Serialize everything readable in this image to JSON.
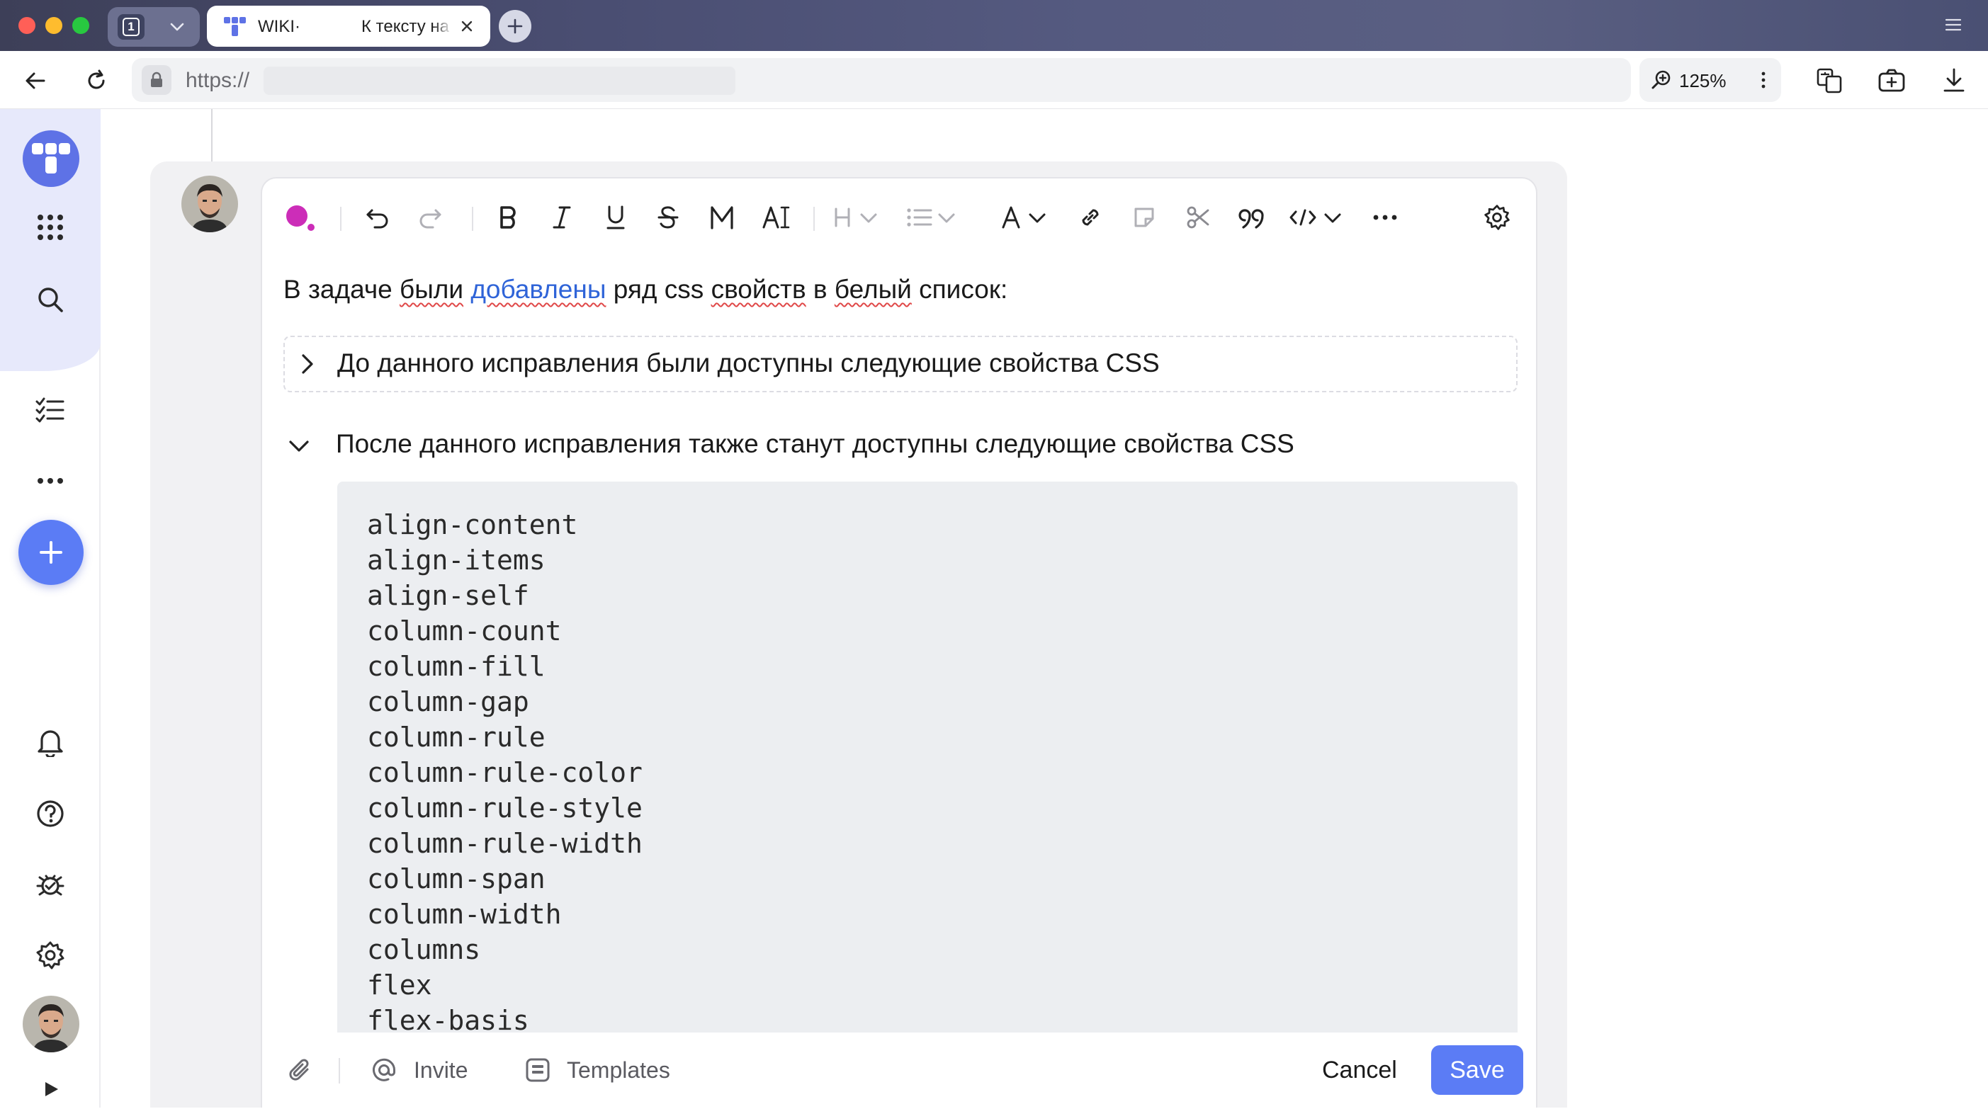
{
  "browser": {
    "tab_group_count": "1",
    "tab": {
      "title_prefix": "WIKI·",
      "title": "К тексту на"
    },
    "url": "https://",
    "zoom": "125%"
  },
  "editor": {
    "paragraph": {
      "before_link": "В задаче ",
      "w1": "были",
      "link_text": "добавлены",
      "w2": " ряд css ",
      "w3": "свойств",
      "w4": " в ",
      "w5": "белый",
      "after": " список:"
    },
    "cut_collapsed_title": "До данного исправления были доступны следующие свойства CSS",
    "cut_expanded_title": "После данного исправления также станут доступны следующие свойства CSS",
    "code_lines": "align-content\nalign-items\nalign-self\ncolumn-count\ncolumn-fill\ncolumn-gap\ncolumn-rule\ncolumn-rule-color\ncolumn-rule-style\ncolumn-rule-width\ncolumn-span\ncolumn-width\ncolumns\nflex\nflex-basis",
    "footer": {
      "invite_label": "Invite",
      "templates_label": "Templates",
      "cancel_label": "Cancel",
      "save_label": "Save"
    }
  },
  "colors": {
    "accent": "#5b7cf5",
    "text_color_dot": "#cc2db8",
    "link": "#2f64d8"
  }
}
